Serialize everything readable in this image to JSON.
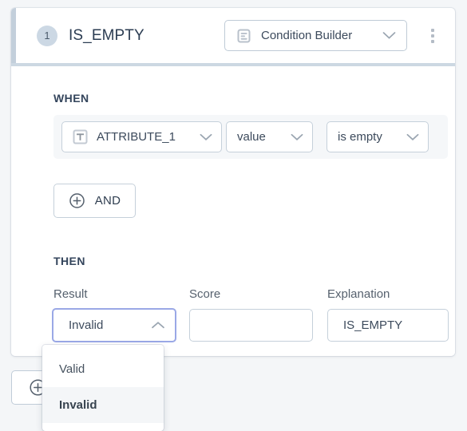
{
  "rule": {
    "step_number": "1",
    "title": "IS_EMPTY",
    "builder_label": "Condition Builder",
    "builder_icon": "document-list-icon",
    "chevron_icon": "chevron-down-icon",
    "kebab_icon": "more-vertical-icon",
    "accent_color": "#c3cfdb"
  },
  "when": {
    "label": "WHEN",
    "condition": {
      "attribute": "ATTRIBUTE_1",
      "attribute_icon": "text-type-icon",
      "property": "value",
      "operator": "is empty"
    },
    "add_condition_button": "AND",
    "add_condition_icon": "plus-circle-icon"
  },
  "then": {
    "label": "THEN",
    "fields": {
      "result_label": "Result",
      "result_value": "Invalid",
      "result_chevron": "chevron-up-icon",
      "score_label": "Score",
      "score_value": "",
      "score_placeholder": "",
      "explanation_label": "Explanation",
      "explanation_value": "IS_EMPTY"
    },
    "result_dropdown": {
      "open": true,
      "focus_color": "#9aa8e6",
      "options": [
        {
          "label": "Valid",
          "selected": false
        },
        {
          "label": "Invalid",
          "selected": true
        }
      ]
    }
  },
  "footer": {
    "add_rule_icon": "plus-circle-icon"
  }
}
